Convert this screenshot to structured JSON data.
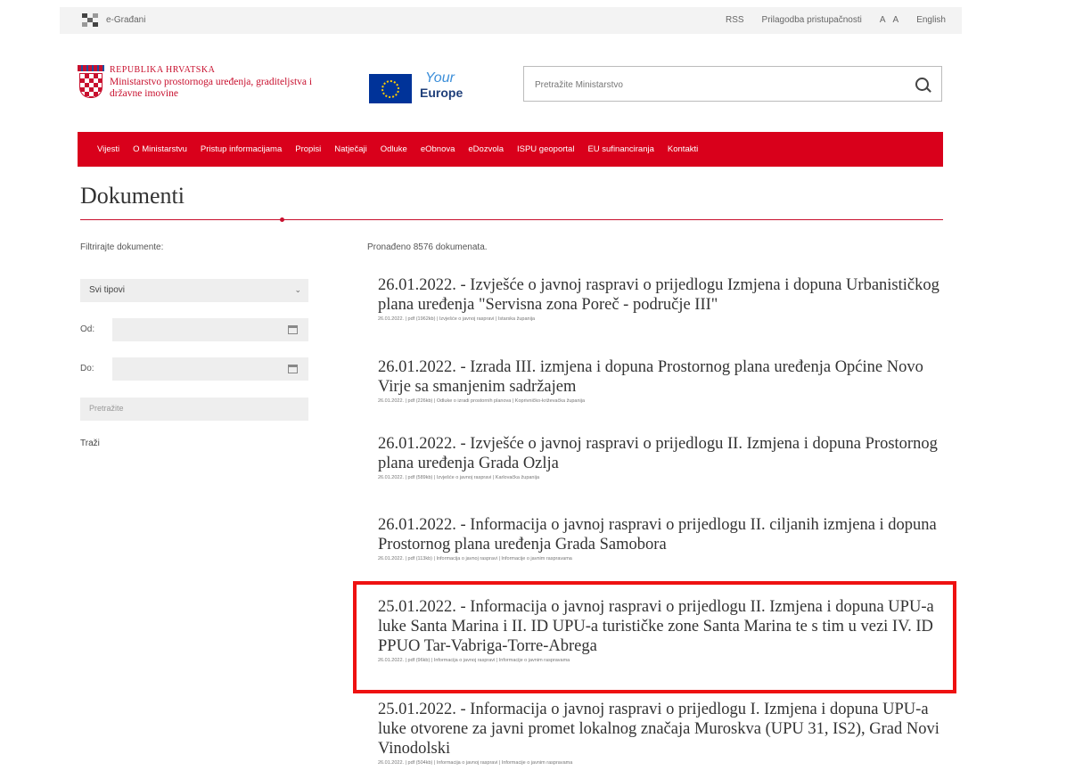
{
  "topbar": {
    "portal_label": "e-Građani",
    "links": [
      "RSS",
      "Prilagodba pristupačnosti",
      "A",
      "A",
      "English"
    ]
  },
  "header": {
    "country": "REPUBLIKA HRVATSKA",
    "ministry": "Ministarstvo prostornoga uređenja, graditeljstva i državne imovine",
    "your_europe_1": "Your",
    "your_europe_2": "Europe",
    "search_placeholder": "Pretražite Ministarstvo"
  },
  "nav": {
    "items": [
      "Vijesti",
      "O Ministarstvu",
      "Pristup informacijama",
      "Propisi",
      "Natječaji",
      "Odluke",
      "eObnova",
      "eDozvola",
      "ISPU geoportal",
      "EU sufinanciranja",
      "Kontakti"
    ]
  },
  "page": {
    "title": "Dokumenti"
  },
  "sidebar": {
    "filter_label": "Filtrirajte dokumente:",
    "type_select": "Svi tipovi",
    "from_label": "Od:",
    "to_label": "Do:",
    "search_placeholder": "Pretražite",
    "search_button": "Traži"
  },
  "results": {
    "count_text": "Pronađeno 8576 dokumenata.",
    "items": [
      {
        "title": "26.01.2022. - Izvješće o javnoj raspravi o prijedlogu Izmjena i dopuna Urbanističkog plana uređenja \"Servisna zona Poreč - područje III\"",
        "meta": "26.01.2022. | pdf (1962kb) | Izvješće o javnoj raspravi | Istarska županija"
      },
      {
        "title": "26.01.2022. - Izrada III. izmjena i dopuna Prostornog plana uređenja Općine Novo Virje sa smanjenim sadržajem",
        "meta": "26.01.2022. | pdf (226kb) | Odluke o izradi prostornih planova | Koprivničko-križevačka županija"
      },
      {
        "title": "26.01.2022. - Izvješće o javnoj raspravi o prijedlogu II. Izmjena i dopuna Prostornog plana uređenja Grada Ozlja",
        "meta": "26.01.2022. | pdf (589kb) | Izvješće o javnoj raspravi | Karlovačka županija"
      },
      {
        "title": "26.01.2022. - Informacija o javnoj raspravi o prijedlogu II. ciljanih izmjena i dopuna Prostornog plana uređenja Grada Samobora",
        "meta": "26.01.2022. | pdf (113kb) | Informacija o javnoj raspravi | Informacije o javnim raspravama"
      },
      {
        "title": "25.01.2022. - Informacija o javnoj raspravi o prijedlogu II. Izmjena i dopuna UPU-a luke Santa Marina i II. ID UPU-a turističke zone Santa Marina te s tim u vezi IV. ID PPUO Tar-Vabriga-Torre-Abrega",
        "meta": "26.01.2022. | pdf (96kb) | Informacija o javnoj raspravi | Informacije o javnim raspravama"
      },
      {
        "title": "25.01.2022. - Informacija o javnoj raspravi o prijedlogu I. Izmjena i dopuna UPU-a luke otvorene za javni promet lokalnog značaja Muroskva (UPU 31, IS2), Grad Novi Vinodolski",
        "meta": "26.01.2022. | pdf (504kb) | Informacija o javnoj raspravi | Informacije o javnim raspravama"
      }
    ]
  },
  "colors": {
    "nav_red": "#d9001b",
    "highlight": "#ee1111"
  }
}
